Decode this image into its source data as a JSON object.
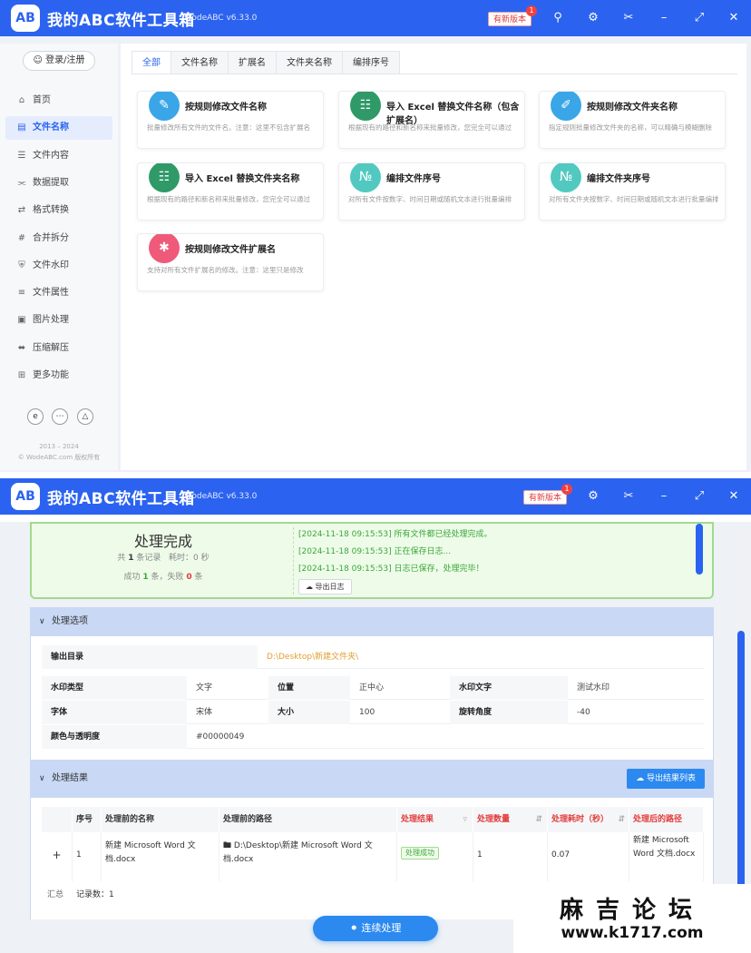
{
  "app": {
    "title": "我的ABC软件工具箱",
    "version": "WodeABC v6.33.0",
    "logo": "AB",
    "new_version": "有新版本",
    "new_version_count": "1",
    "brand_color": "#2b63f0"
  },
  "win1": {
    "login": "登录/注册",
    "nav": [
      {
        "label": "首页",
        "icon": "home-icon"
      },
      {
        "label": "文件名称",
        "icon": "file-icon",
        "active": true
      },
      {
        "label": "文件内容",
        "icon": "list-icon"
      },
      {
        "label": "数据提取",
        "icon": "share-icon"
      },
      {
        "label": "格式转换",
        "icon": "convert-icon"
      },
      {
        "label": "合并拆分",
        "icon": "hash-icon"
      },
      {
        "label": "文件水印",
        "icon": "shield-icon"
      },
      {
        "label": "文件属性",
        "icon": "properties-icon"
      },
      {
        "label": "图片处理",
        "icon": "image-icon"
      },
      {
        "label": "压缩解压",
        "icon": "compress-icon"
      },
      {
        "label": "更多功能",
        "icon": "grid-icon"
      }
    ],
    "copyright_years": "2013 – 2024",
    "copyright": "© WodeABC.com 版权所有",
    "tabs": [
      "全部",
      "文件名称",
      "扩展名",
      "文件夹名称",
      "编排序号"
    ],
    "cards": [
      {
        "title": "按规则修改文件名称",
        "desc": "批量修改所有文件的文件名。注意：这里不包含扩展名",
        "color": "#3aa6e8"
      },
      {
        "title": "导入 Excel 替换文件名称（包含扩展名）",
        "desc": "根据现有的路径和新名称来批量修改，您完全可以通过",
        "color": "#2f9a68"
      },
      {
        "title": "按规则修改文件夹名称",
        "desc": "指定规则批量修改文件夹的名称，可以精确与模糊删除",
        "color": "#3aa6e8"
      },
      {
        "title": "导入 Excel 替换文件夹名称",
        "desc": "根据现有的路径和新名称来批量修改，您完全可以通过",
        "color": "#2f9a68"
      },
      {
        "title": "编排文件序号",
        "desc": "对所有文件按数字、时间日期或随机文本进行批量编排",
        "color": "#52c9c0"
      },
      {
        "title": "编排文件夹序号",
        "desc": "对所有文件夹按数字、时间日期或随机文本进行批量编排",
        "color": "#52c9c0"
      },
      {
        "title": "按规则修改文件扩展名",
        "desc": "支持对所有文件扩展名的修改。注意：这里只是修改",
        "color": "#ef5a7a"
      }
    ]
  },
  "win2": {
    "summary": {
      "title": "处理完成",
      "total_prefix": "共",
      "total": "1",
      "total_suffix": "条记录",
      "time_label": "耗时：",
      "time": "0",
      "time_unit": "秒",
      "success_prefix": "成功",
      "success": "1",
      "success_suffix": "条，失败",
      "fail": "0",
      "fail_suffix": "条"
    },
    "logs": [
      "[2024-11-18 09:15:53] 所有文件都已经处理完成。",
      "[2024-11-18 09:15:53] 正在保存日志...",
      "[2024-11-18 09:15:53] 日志已保存，处理完毕！"
    ],
    "export_log": "导出日志",
    "options_section": "处理选项",
    "output_dir_label": "输出目录",
    "output_dir": "D:\\Desktop\\新建文件夹\\",
    "options": [
      [
        {
          "l": "水印类型",
          "v": "文字"
        },
        {
          "l": "位置",
          "v": "正中心"
        },
        {
          "l": "水印文字",
          "v": "测试水印"
        }
      ],
      [
        {
          "l": "字体",
          "v": "宋体"
        },
        {
          "l": "大小",
          "v": "100"
        },
        {
          "l": "旋转角度",
          "v": "-40"
        }
      ],
      [
        {
          "l": "颜色与透明度",
          "v": "#00000049"
        }
      ]
    ],
    "results_section": "处理结果",
    "export_results": "导出结果列表",
    "columns": [
      "序号",
      "处理前的名称",
      "处理前的路径",
      "处理结果",
      "处理数量",
      "处理耗时（秒）",
      "处理后的路径"
    ],
    "row": {
      "expand": "+",
      "index": "1",
      "name": "新建 Microsoft Word 文档.docx",
      "path": "D:\\Desktop\\新建 Microsoft Word 文档.docx",
      "result": "处理成功",
      "count": "1",
      "time": "0.07",
      "out": "新建 Microsoft Word 文档.docx"
    },
    "footer_label": "汇总",
    "footer_count": "记录数：1",
    "continue_btn": "连续处理",
    "watermark_cn": "麻吉论坛",
    "watermark_url": "www.k1717.com"
  }
}
